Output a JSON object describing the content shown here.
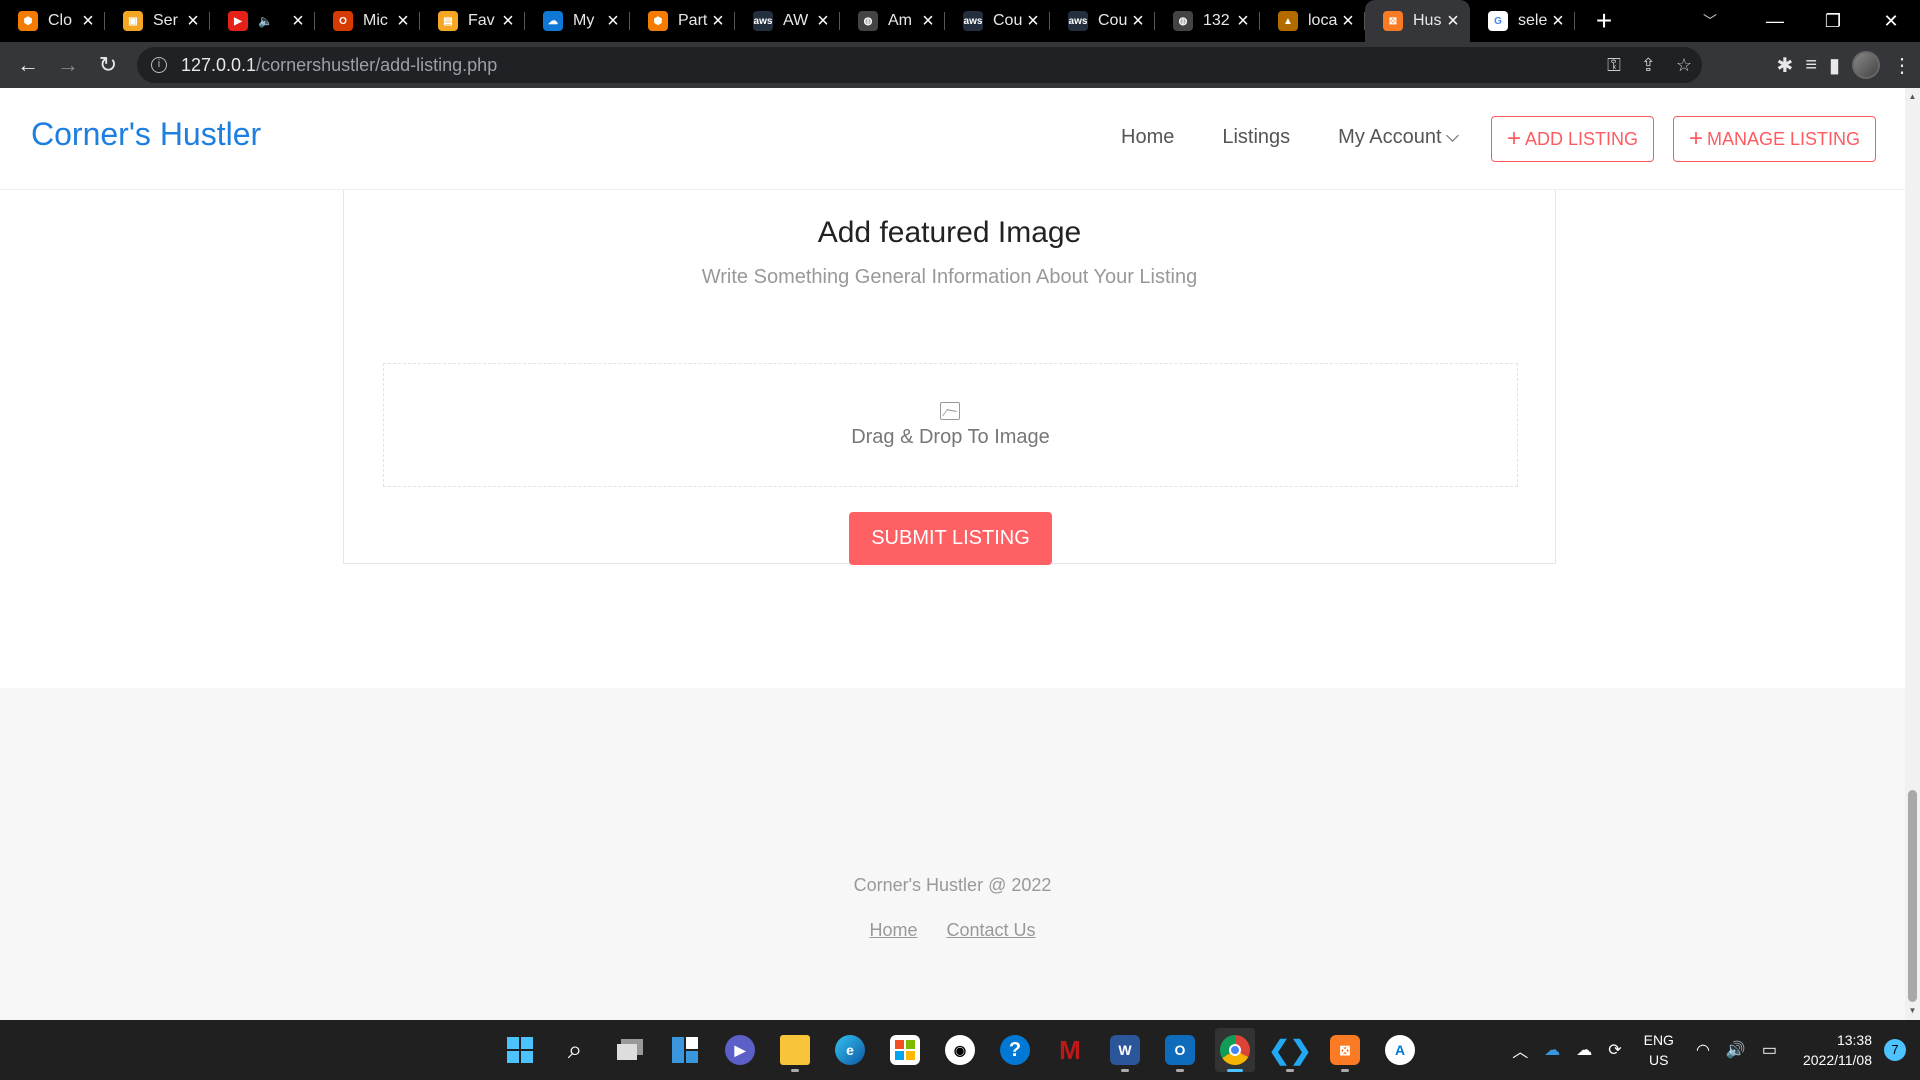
{
  "browser": {
    "tabs": [
      {
        "title": "Clo",
        "color": "#f57c00",
        "glyph": "⬢"
      },
      {
        "title": "Ser",
        "color": "#f5a623",
        "glyph": "▣"
      },
      {
        "title": "",
        "color": "#e62117",
        "glyph": "▶",
        "muted": "🔈"
      },
      {
        "title": "Mic",
        "color": "#d83b01",
        "glyph": "O"
      },
      {
        "title": "Fav",
        "color": "#f5a623",
        "glyph": "▤"
      },
      {
        "title": "My",
        "color": "#0f78d4",
        "glyph": "☁"
      },
      {
        "title": "Part",
        "color": "#f57c00",
        "glyph": "⬢"
      },
      {
        "title": "AW",
        "color": "#232f3e",
        "glyph": "aws"
      },
      {
        "title": "Am",
        "color": "#444",
        "glyph": "◍"
      },
      {
        "title": "Cou",
        "color": "#232f3e",
        "glyph": "aws"
      },
      {
        "title": "Cou",
        "color": "#232f3e",
        "glyph": "aws"
      },
      {
        "title": "132",
        "color": "#444",
        "glyph": "◍"
      },
      {
        "title": "loca",
        "color": "#b36b00",
        "glyph": "▲"
      },
      {
        "title": "Hus",
        "color": "#fb7a24",
        "glyph": "⊠",
        "active": true
      },
      {
        "title": "sele",
        "color": "#fff",
        "glyph": "G"
      }
    ],
    "url_host": "127.0.0.1",
    "url_path": "/cornershustler/add-listing.php"
  },
  "site": {
    "logo": "Corner's Hustler",
    "nav": {
      "home": "Home",
      "listings": "Listings",
      "account": "My Account"
    },
    "add_listing": "ADD LISTING",
    "manage_listing": "MANAGE LISTING"
  },
  "card": {
    "title": "Add featured Image",
    "subtitle": "Write Something General Information About Your Listing",
    "dropzone_text": "Drag & Drop To Image",
    "submit": "SUBMIT LISTING"
  },
  "footer": {
    "copyright": "Corner's Hustler @ 2022",
    "links": [
      "Home",
      "Contact Us"
    ]
  },
  "taskbar": {
    "lang_top": "ENG",
    "lang_bottom": "US",
    "time": "13:38",
    "date": "2022/11/08",
    "notifications": "7"
  },
  "colors": {
    "brand_blue": "#1e7fe0",
    "accent_red": "#ff5a5f",
    "submit_red": "#ff6063"
  }
}
